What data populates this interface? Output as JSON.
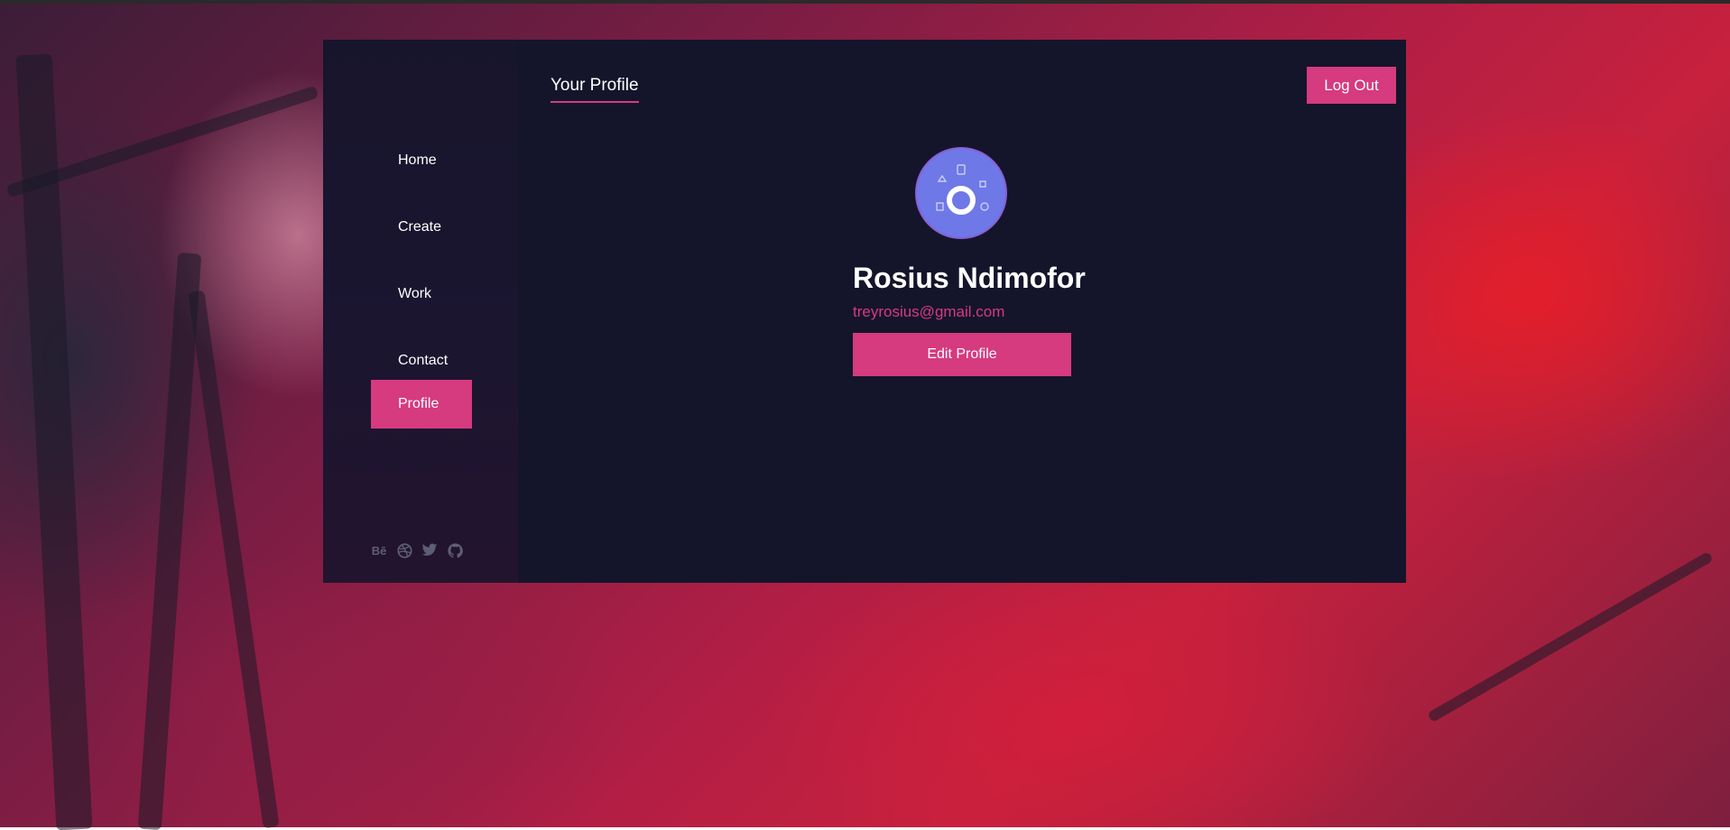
{
  "sidebar": {
    "items": [
      {
        "label": "Home",
        "active": false
      },
      {
        "label": "Create",
        "active": false
      },
      {
        "label": "Work",
        "active": false
      },
      {
        "label": "Contact",
        "active": false
      },
      {
        "label": "Profile",
        "active": true
      }
    ],
    "social": [
      {
        "icon": "behance-icon",
        "glyph": "Bē"
      },
      {
        "icon": "dribbble-icon"
      },
      {
        "icon": "twitter-icon"
      },
      {
        "icon": "github-icon"
      }
    ]
  },
  "header": {
    "title": "Your Profile",
    "logout_label": "Log Out"
  },
  "profile": {
    "name": "Rosius Ndimofor",
    "email": "treyrosius@gmail.com",
    "edit_label": "Edit Profile",
    "avatar_icon": "avatar-icon"
  },
  "colors": {
    "accent": "#d63a7f",
    "card": "#14152b",
    "avatar": "#6e78e6"
  }
}
